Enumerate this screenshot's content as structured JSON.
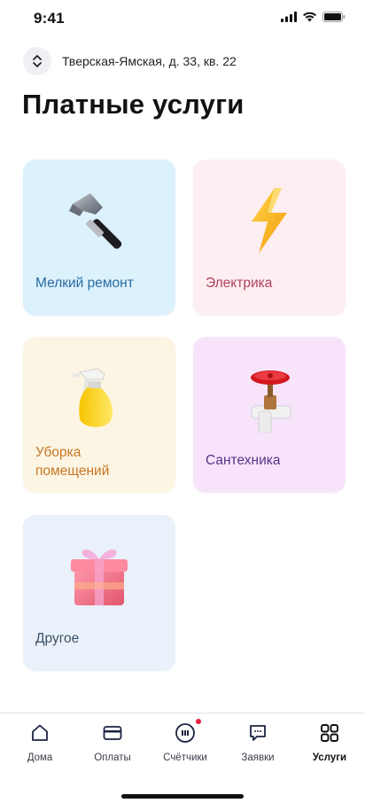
{
  "status_bar": {
    "time": "9:41"
  },
  "address": {
    "text": "Тверская-Ямская, д. 33, кв. 22"
  },
  "page": {
    "title": "Платные услуги"
  },
  "services": [
    {
      "label": "Мелкий ремонт",
      "icon": "hammer-icon"
    },
    {
      "label": "Электрика",
      "icon": "lightning-icon"
    },
    {
      "label": "Уборка\nпомещений",
      "icon": "spray-bottle-icon"
    },
    {
      "label": "Сантехника",
      "icon": "valve-icon"
    },
    {
      "label": "Другое",
      "icon": "gift-icon"
    }
  ],
  "tab_bar": {
    "items": [
      {
        "label": "Дома",
        "icon": "house-icon",
        "active": false
      },
      {
        "label": "Оплаты",
        "icon": "card-icon",
        "active": false
      },
      {
        "label": "Счётчики",
        "icon": "meter-icon",
        "active": false,
        "badge": true
      },
      {
        "label": "Заявки",
        "icon": "chat-icon",
        "active": false
      },
      {
        "label": "Услуги",
        "icon": "grid-icon",
        "active": true
      }
    ]
  },
  "colors": {
    "repair_bg": "#dbf1fb",
    "electric_bg": "#fdeef1",
    "cleaning_bg": "#fdf5e3",
    "plumbing_bg": "#f7e4fb",
    "other_bg": "#eaf1fa",
    "badge": "#e5213b"
  }
}
